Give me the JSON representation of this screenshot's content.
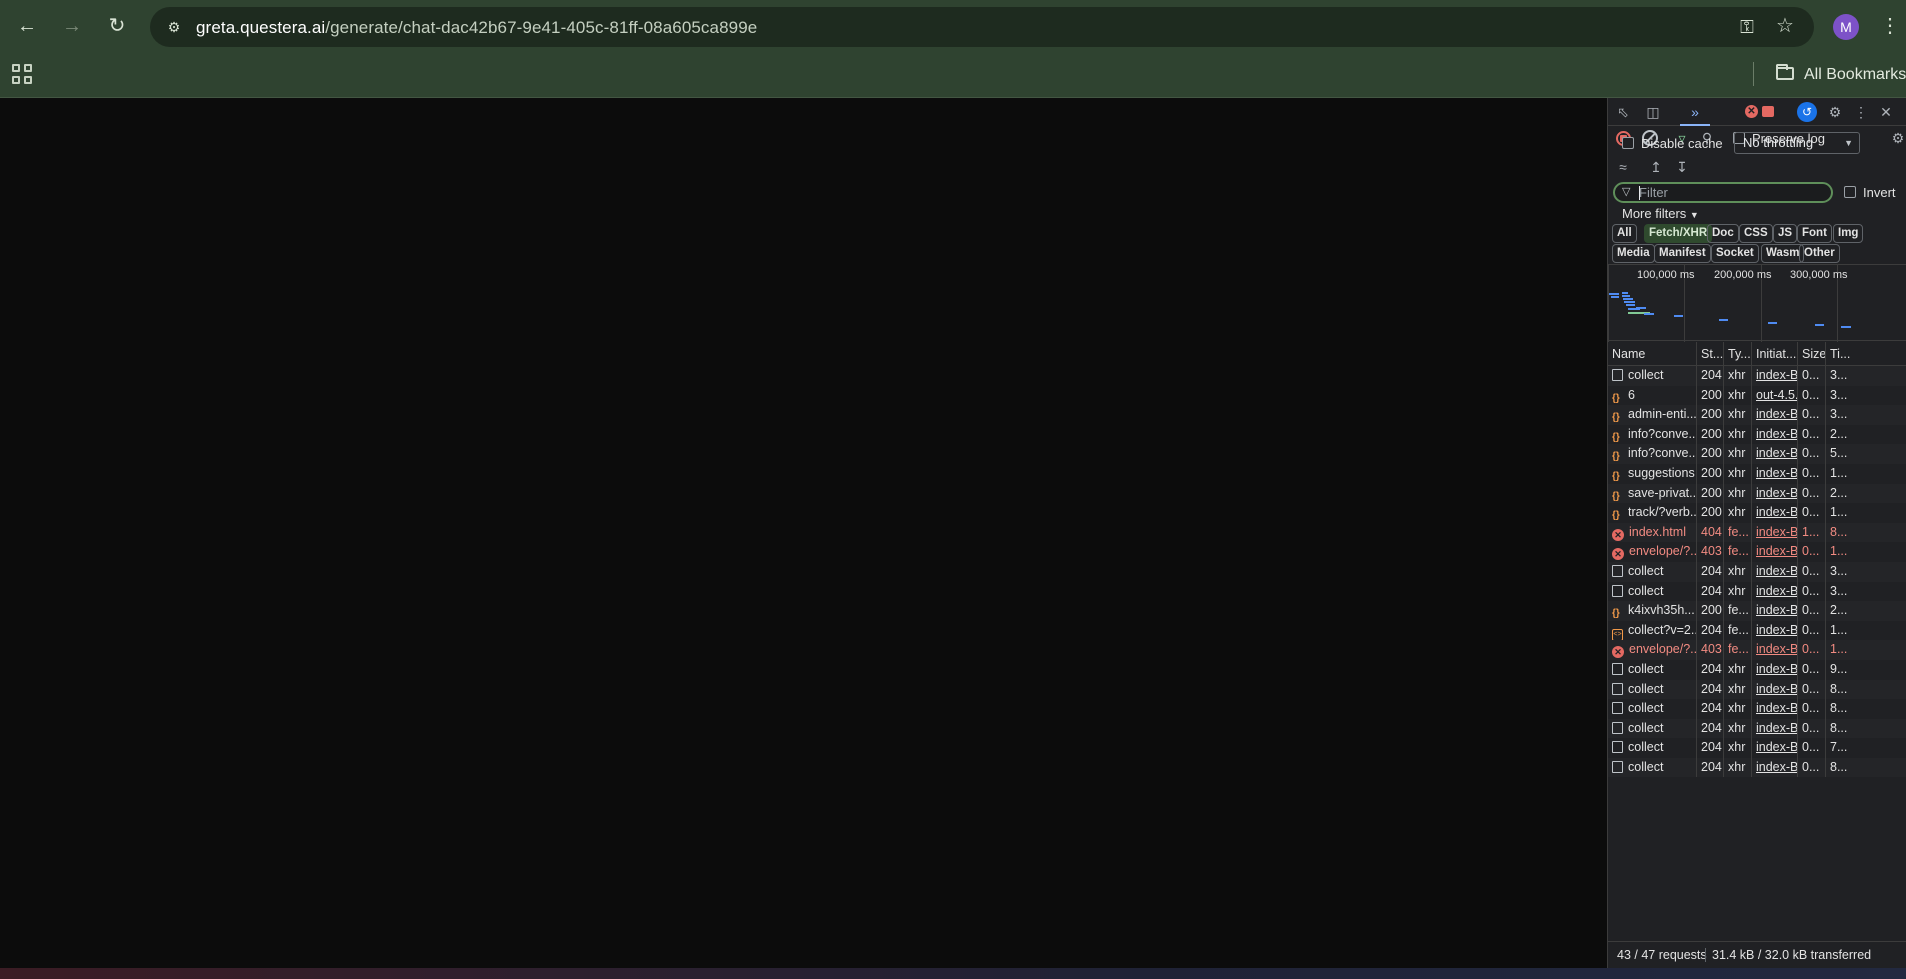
{
  "browser": {
    "url_host": "greta.questera.ai",
    "url_path": "/generate/chat-dac42b67-9e41-405c-81ff-08a605ca899e",
    "profile_initial": "M",
    "bookmarks_label": "All Bookmarks",
    "accent_color": "#2f4330"
  },
  "devtools": {
    "preserve_log_label": "Preserve log",
    "disable_cache_label": "Disable cache",
    "throttling_value": "No throttling",
    "filter_placeholder": "Filter",
    "invert_label": "Invert",
    "more_filters_label": "More filters",
    "type_filters": [
      "All",
      "Fetch/XHR",
      "Doc",
      "CSS",
      "JS",
      "Font",
      "Img",
      "Media",
      "Manifest",
      "Socket",
      "Wasm",
      "Other"
    ],
    "active_filter": "Fetch/XHR",
    "overview_labels": [
      "100,000 ms",
      "200,000 ms",
      "300,000 ms"
    ],
    "columns": [
      "Name",
      "St...",
      "Ty...",
      "Initiat...",
      "Size",
      "Ti..."
    ],
    "requests": [
      {
        "name": "collect",
        "status": "204",
        "type": "xhr",
        "initiator": "index-Bc",
        "size": "0...",
        "time": "3...",
        "icon": "doc-icon",
        "error": false
      },
      {
        "name": "6",
        "status": "200",
        "type": "xhr",
        "initiator": "out-4.5.4",
        "size": "0...",
        "time": "3...",
        "icon": "fetch-icon",
        "error": false
      },
      {
        "name": "admin-enti...",
        "status": "200",
        "type": "xhr",
        "initiator": "index-Bc",
        "size": "0...",
        "time": "3...",
        "icon": "fetch-icon",
        "error": false
      },
      {
        "name": "info?conve...",
        "status": "200",
        "type": "xhr",
        "initiator": "index-Bc",
        "size": "0...",
        "time": "2...",
        "icon": "fetch-icon",
        "error": false
      },
      {
        "name": "info?conve...",
        "status": "200",
        "type": "xhr",
        "initiator": "index-Bc",
        "size": "0...",
        "time": "5...",
        "icon": "fetch-icon",
        "error": false
      },
      {
        "name": "suggestions",
        "status": "200",
        "type": "xhr",
        "initiator": "index-Bc",
        "size": "0...",
        "time": "1...",
        "icon": "fetch-icon",
        "error": false
      },
      {
        "name": "save-privat...",
        "status": "200",
        "type": "xhr",
        "initiator": "index-Bc",
        "size": "0...",
        "time": "2...",
        "icon": "fetch-icon",
        "error": false
      },
      {
        "name": "track/?verb...",
        "status": "200",
        "type": "xhr",
        "initiator": "index-Bc",
        "size": "0...",
        "time": "1...",
        "icon": "fetch-icon",
        "error": false
      },
      {
        "name": "index.html",
        "status": "404",
        "type": "fe...",
        "initiator": "index-Bc",
        "size": "1...",
        "time": "8...",
        "icon": "error-icon",
        "error": true
      },
      {
        "name": "envelope/?...",
        "status": "403",
        "type": "fe...",
        "initiator": "index-Bc",
        "size": "0...",
        "time": "1...",
        "icon": "error-icon",
        "error": true
      },
      {
        "name": "collect",
        "status": "204",
        "type": "xhr",
        "initiator": "index-Bc",
        "size": "0...",
        "time": "3...",
        "icon": "doc-icon",
        "error": false
      },
      {
        "name": "collect",
        "status": "204",
        "type": "xhr",
        "initiator": "index-Bc",
        "size": "0...",
        "time": "3...",
        "icon": "doc-icon",
        "error": false
      },
      {
        "name": "k4ixvh35h...",
        "status": "200",
        "type": "fe...",
        "initiator": "index-Bc",
        "size": "0...",
        "time": "2...",
        "icon": "fetch-icon",
        "error": false
      },
      {
        "name": "collect?v=2...",
        "status": "204",
        "type": "fe...",
        "initiator": "index-Bc",
        "size": "0...",
        "time": "1...",
        "icon": "script-icon",
        "error": false
      },
      {
        "name": "envelope/?...",
        "status": "403",
        "type": "fe...",
        "initiator": "index-Bc",
        "size": "0...",
        "time": "1...",
        "icon": "error-icon",
        "error": true
      },
      {
        "name": "collect",
        "status": "204",
        "type": "xhr",
        "initiator": "index-Bc",
        "size": "0...",
        "time": "9...",
        "icon": "doc-icon",
        "error": false
      },
      {
        "name": "collect",
        "status": "204",
        "type": "xhr",
        "initiator": "index-Bc",
        "size": "0...",
        "time": "8...",
        "icon": "doc-icon",
        "error": false
      },
      {
        "name": "collect",
        "status": "204",
        "type": "xhr",
        "initiator": "index-Bc",
        "size": "0...",
        "time": "8...",
        "icon": "doc-icon",
        "error": false
      },
      {
        "name": "collect",
        "status": "204",
        "type": "xhr",
        "initiator": "index-Bc",
        "size": "0...",
        "time": "8...",
        "icon": "doc-icon",
        "error": false
      },
      {
        "name": "collect",
        "status": "204",
        "type": "xhr",
        "initiator": "index-Bc",
        "size": "0...",
        "time": "7...",
        "icon": "doc-icon",
        "error": false
      },
      {
        "name": "collect",
        "status": "204",
        "type": "xhr",
        "initiator": "index-Bc",
        "size": "0...",
        "time": "8...",
        "icon": "doc-icon",
        "error": false
      }
    ],
    "summary_requests": "43 / 47 requests",
    "summary_transfer": "31.4 kB / 32.0 kB transferred",
    "error_color": "#f28b82"
  }
}
